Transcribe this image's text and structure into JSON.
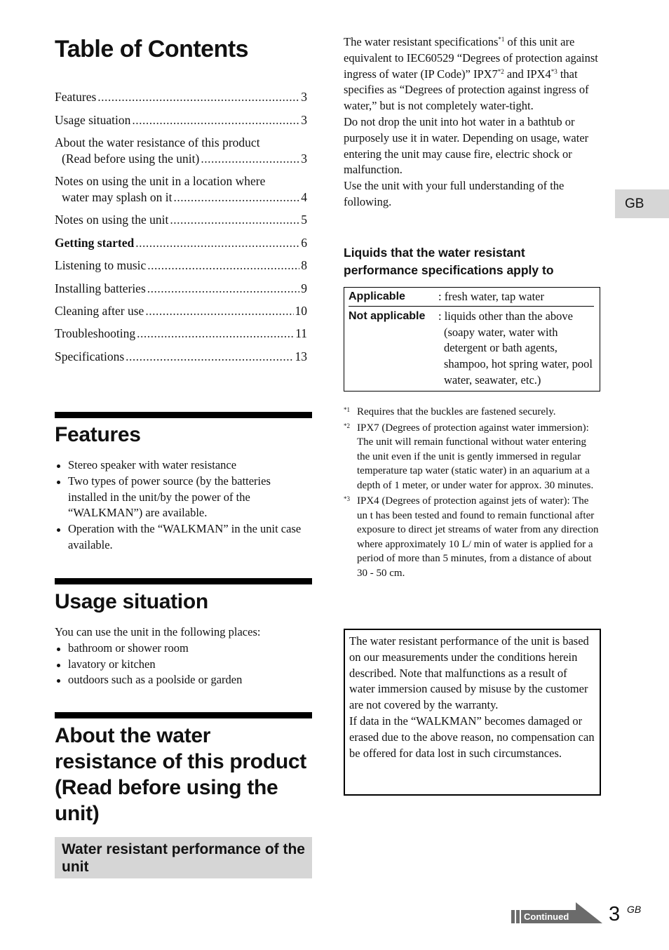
{
  "toc": {
    "title": "Table of Contents",
    "items": [
      {
        "label": "Features",
        "page": "3"
      },
      {
        "label": "Usage situation",
        "page": "3"
      },
      {
        "label_line1": "About the water resistance of this product",
        "label": "(Read before using the unit)",
        "page": "3"
      },
      {
        "label_line1": "Notes on using the unit in a location where",
        "label": "water may splash on it",
        "page": "4"
      },
      {
        "label": "Notes on using the unit",
        "page": "5"
      },
      {
        "label": "Getting started",
        "page": "6",
        "bold": true
      },
      {
        "label": "Listening to music",
        "page": "8"
      },
      {
        "label": "Installing batteries",
        "page": "9"
      },
      {
        "label": "Cleaning after use",
        "page": "10"
      },
      {
        "label": "Troubleshooting",
        "page": "11"
      },
      {
        "label": "Specifications",
        "page": "13"
      }
    ]
  },
  "features": {
    "heading": "Features",
    "bullets": [
      "Stereo speaker with water resistance",
      "Two types of power source (by the batteries installed in the unit/by the power of the “WALKMAN”) are available.",
      "Operation with the “WALKMAN” in the unit case available."
    ]
  },
  "usage": {
    "heading": "Usage situation",
    "intro": "You can use the unit in the following places:",
    "bullets": [
      "bathroom or shower room",
      "lavatory or kitchen",
      "outdoors such as a poolside or garden"
    ]
  },
  "water_resistance": {
    "heading": "About the water resistance of this product (Read before using the unit)",
    "subheading": "Water resistant performance of the unit",
    "para1_a": "The water resistant specifications",
    "para1_sup1": "*1",
    "para1_b": " of this unit are equivalent to IEC60529 “Degrees of protection against ingress of water (IP Code)” IPX7",
    "para1_sup2": "*2",
    "para1_c": " and IPX4",
    "para1_sup3": "*3",
    "para1_d": " that specifies as “Degrees of protection against ingress of water,” but is not completely water-tight.",
    "para2": "Do not drop the unit into hot water in a bathtub or purposely use it in water. Depending on usage, water entering the unit may cause fire, electric shock or malfunction.",
    "para3": "Use the unit with your full understanding of the following.",
    "liquids_heading": "Liquids that the water resistant performance specifications apply to",
    "liquids_table": [
      {
        "key": "Applicable",
        "value": ": fresh water, tap water"
      },
      {
        "key": "Not applicable",
        "value": ": liquids other than the above (soapy water, water with detergent or bath agents, shampoo, hot spring water, pool water, seawater, etc.)"
      }
    ],
    "notes": [
      {
        "mark": "*1",
        "text": "Requires that the buckles are fastened securely."
      },
      {
        "mark": "*2",
        "text": "IPX7 (Degrees of protection against water immersion): The unit will remain functional without water entering the unit even if the unit is gently immersed in regular temperature tap water (static water) in an aquarium at a depth of 1 meter, or under water for approx. 30 minutes."
      },
      {
        "mark": "*3",
        "text": "IPX4 (Degrees of protection against jets of water): The un t has been tested and found to remain functional after exposure to direct jet streams of water from any direction where approximately 10 L/ min of water is applied for a period of more than 5 minutes, from a distance of about 30 - 50 cm."
      }
    ],
    "warning_para1": "The water resistant performance of the unit is based on our measurements under the conditions herein described. Note that malfunctions as a result of water immersion caused by misuse by the customer are not covered by the warranty.",
    "warning_para2": "If data in the “WALKMAN” becomes damaged or erased due to the above reason, no compensation can be offered for data lost in such circumstances."
  },
  "side_tab": {
    "label": "GB"
  },
  "footer": {
    "continued_label": "Continued",
    "page_number": "3",
    "page_suffix": "GB"
  }
}
